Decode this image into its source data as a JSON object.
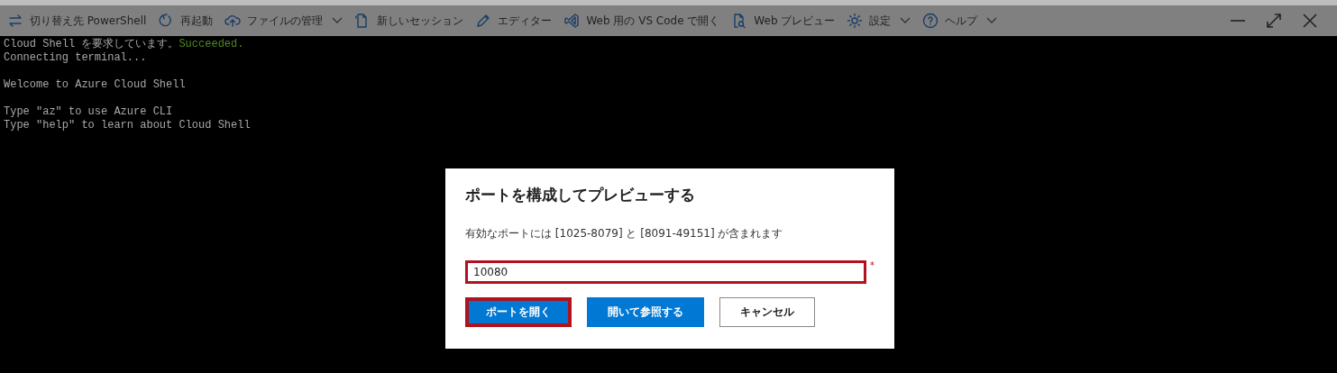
{
  "toolbar": {
    "items": [
      {
        "label": "切り替え先 PowerShell",
        "dropdown": false
      },
      {
        "label": "再起動",
        "dropdown": false
      },
      {
        "label": "ファイルの管理",
        "dropdown": true
      },
      {
        "label": "新しいセッション",
        "dropdown": false
      },
      {
        "label": "エディター",
        "dropdown": false
      },
      {
        "label": "Web 用の VS Code で開く",
        "dropdown": false
      },
      {
        "label": "Web プレビュー",
        "dropdown": false
      },
      {
        "label": "設定",
        "dropdown": true
      },
      {
        "label": "ヘルプ",
        "dropdown": true
      }
    ]
  },
  "terminal": {
    "blocks": [
      [
        {
          "text": "Cloud Shell を要求しています。",
          "status": "Succeeded."
        },
        {
          "text": "Connecting terminal..."
        }
      ],
      [
        {
          "text": "Welcome to Azure Cloud Shell"
        }
      ],
      [
        {
          "text": "Type \"az\" to use Azure CLI"
        },
        {
          "text": "Type \"help\" to learn about Cloud Shell"
        }
      ]
    ]
  },
  "dialog": {
    "title": "ポートを構成してプレビューする",
    "description": "有効なポートには [1025-8079] と [8091-49151] が含まれます",
    "port_field": {
      "value": "10080",
      "required_mark": "*",
      "highlighted": true
    },
    "buttons": [
      {
        "label": "ポートを開く",
        "kind": "primary",
        "highlighted": true
      },
      {
        "label": "開いて参照する",
        "kind": "primary",
        "highlighted": false
      },
      {
        "label": "キャンセル",
        "kind": "secondary",
        "highlighted": false
      }
    ]
  }
}
